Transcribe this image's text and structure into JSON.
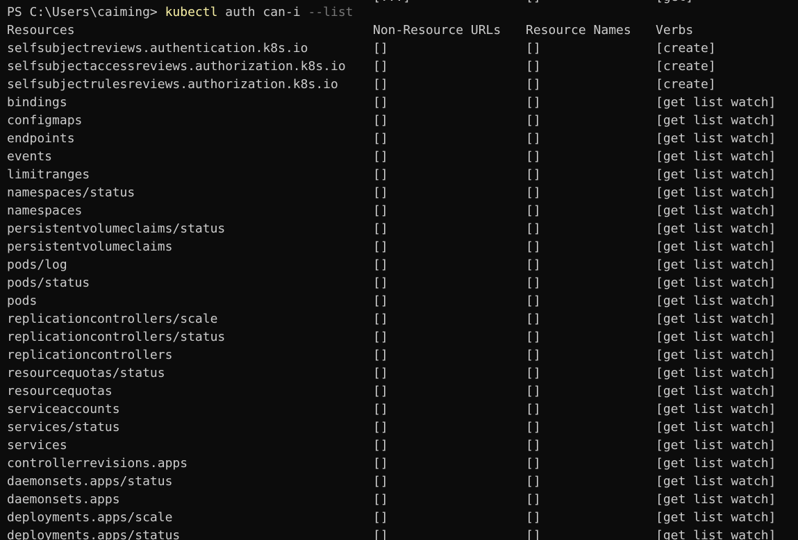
{
  "terminal": {
    "partial_top_row": [
      "[...]",
      "[]",
      "[get]"
    ],
    "prompt": {
      "path": "PS C:\\Users\\caiming> ",
      "command": "kubectl",
      "args": "auth can-i",
      "flag": "--list"
    },
    "headers": [
      "Resources",
      "Non-Resource URLs",
      "Resource Names",
      "Verbs"
    ],
    "rows": [
      [
        "selfsubjectreviews.authentication.k8s.io",
        "[]",
        "[]",
        "[create]"
      ],
      [
        "selfsubjectaccessreviews.authorization.k8s.io",
        "[]",
        "[]",
        "[create]"
      ],
      [
        "selfsubjectrulesreviews.authorization.k8s.io",
        "[]",
        "[]",
        "[create]"
      ],
      [
        "bindings",
        "[]",
        "[]",
        "[get list watch]"
      ],
      [
        "configmaps",
        "[]",
        "[]",
        "[get list watch]"
      ],
      [
        "endpoints",
        "[]",
        "[]",
        "[get list watch]"
      ],
      [
        "events",
        "[]",
        "[]",
        "[get list watch]"
      ],
      [
        "limitranges",
        "[]",
        "[]",
        "[get list watch]"
      ],
      [
        "namespaces/status",
        "[]",
        "[]",
        "[get list watch]"
      ],
      [
        "namespaces",
        "[]",
        "[]",
        "[get list watch]"
      ],
      [
        "persistentvolumeclaims/status",
        "[]",
        "[]",
        "[get list watch]"
      ],
      [
        "persistentvolumeclaims",
        "[]",
        "[]",
        "[get list watch]"
      ],
      [
        "pods/log",
        "[]",
        "[]",
        "[get list watch]"
      ],
      [
        "pods/status",
        "[]",
        "[]",
        "[get list watch]"
      ],
      [
        "pods",
        "[]",
        "[]",
        "[get list watch]"
      ],
      [
        "replicationcontrollers/scale",
        "[]",
        "[]",
        "[get list watch]"
      ],
      [
        "replicationcontrollers/status",
        "[]",
        "[]",
        "[get list watch]"
      ],
      [
        "replicationcontrollers",
        "[]",
        "[]",
        "[get list watch]"
      ],
      [
        "resourcequotas/status",
        "[]",
        "[]",
        "[get list watch]"
      ],
      [
        "resourcequotas",
        "[]",
        "[]",
        "[get list watch]"
      ],
      [
        "serviceaccounts",
        "[]",
        "[]",
        "[get list watch]"
      ],
      [
        "services/status",
        "[]",
        "[]",
        "[get list watch]"
      ],
      [
        "services",
        "[]",
        "[]",
        "[get list watch]"
      ],
      [
        "controllerrevisions.apps",
        "[]",
        "[]",
        "[get list watch]"
      ],
      [
        "daemonsets.apps/status",
        "[]",
        "[]",
        "[get list watch]"
      ],
      [
        "daemonsets.apps",
        "[]",
        "[]",
        "[get list watch]"
      ],
      [
        "deployments.apps/scale",
        "[]",
        "[]",
        "[get list watch]"
      ],
      [
        "deployments.apps/status",
        "[]",
        "[]",
        "[get list watch]"
      ]
    ],
    "colors": {
      "background": "#0c0c0c",
      "foreground": "#cccccc",
      "command": "#f9f1a5",
      "flag": "#767676"
    }
  }
}
